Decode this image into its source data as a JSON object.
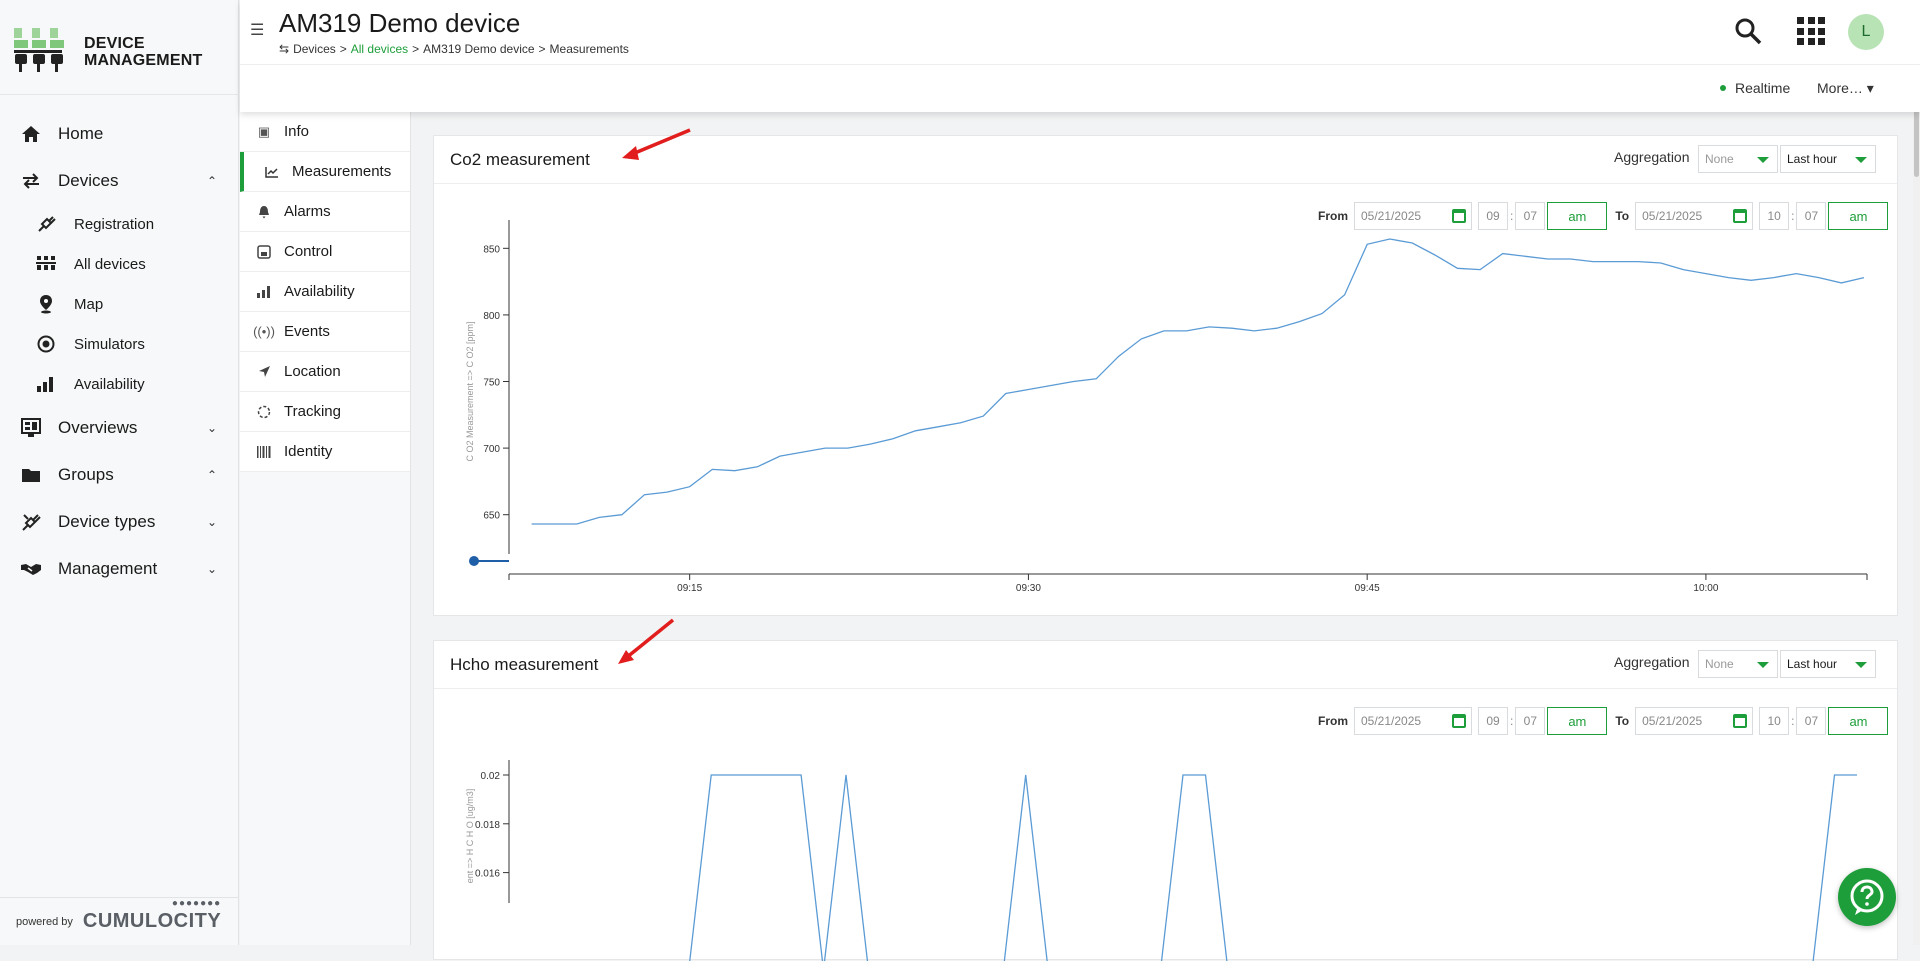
{
  "logo": {
    "line1": "DEVICE",
    "line2": "MANAGEMENT"
  },
  "nav": {
    "home": "Home",
    "devices": "Devices",
    "sub": [
      "Registration",
      "All devices",
      "Map",
      "Simulators",
      "Availability"
    ],
    "overviews": "Overviews",
    "groups": "Groups",
    "device_types": "Device types",
    "management": "Management"
  },
  "footer": {
    "powered": "powered by",
    "brand": "CUMULOCITY"
  },
  "header": {
    "title": "AM319 Demo device",
    "breadcrumb": [
      "Devices",
      ">",
      "All devices",
      ">",
      "AM319 Demo device",
      ">",
      "Measurements"
    ],
    "avatar": "L",
    "realtime": "Realtime",
    "more": "More…"
  },
  "tabs": [
    "Info",
    "Measurements",
    "Alarms",
    "Control",
    "Availability",
    "Events",
    "Location",
    "Tracking",
    "Identity"
  ],
  "cards": [
    {
      "title": "Co2 measurement",
      "aggregation_label": "Aggregation",
      "aggregation_value": "None",
      "interval": "Last hour",
      "from_label": "From",
      "to_label": "To",
      "from_date": "05/21/2025",
      "from_hour": "09",
      "from_min": "07",
      "from_ampm": "am",
      "to_date": "05/21/2025",
      "to_hour": "10",
      "to_min": "07",
      "to_ampm": "am"
    },
    {
      "title": "Hcho measurement",
      "aggregation_label": "Aggregation",
      "aggregation_value": "None",
      "interval": "Last hour",
      "from_label": "From",
      "to_label": "To",
      "from_date": "05/21/2025",
      "from_hour": "09",
      "from_min": "07",
      "from_ampm": "am",
      "to_date": "05/21/2025",
      "to_hour": "10",
      "to_min": "07",
      "to_ampm": "am"
    }
  ],
  "chart_data": [
    {
      "type": "line",
      "ylabel": "C O2 Measurement => C O2 [ppm]",
      "x_ticks": [
        "09:15",
        "09:30",
        "09:45",
        "10:00"
      ],
      "y_ticks": [
        650,
        700,
        750,
        800,
        850
      ],
      "ylim": [
        625,
        860
      ],
      "x_start": "09:07",
      "x_end": "10:07",
      "series": [
        {
          "x_min": [
            8,
            9,
            10,
            11,
            12,
            13,
            14,
            15,
            16,
            17,
            18,
            19,
            20,
            21,
            22,
            23,
            24,
            25,
            26,
            27,
            28,
            29,
            30,
            31,
            32,
            33,
            34,
            35,
            36,
            37,
            38,
            39,
            40,
            41,
            42,
            43,
            44,
            45,
            46,
            47,
            48,
            49,
            50,
            51,
            52,
            53,
            54,
            55,
            56,
            57,
            58,
            59,
            60,
            61,
            62,
            63,
            64,
            65,
            66,
            67
          ],
          "values": [
            643,
            643,
            643,
            648,
            650,
            665,
            667,
            671,
            684,
            683,
            686,
            694,
            697,
            700,
            700,
            703,
            707,
            713,
            716,
            719,
            724,
            741,
            744,
            747,
            750,
            752,
            769,
            782,
            788,
            788,
            791,
            790,
            788,
            790,
            795,
            801,
            815,
            853,
            857,
            854,
            845,
            835,
            834,
            846,
            844,
            842,
            842,
            840,
            840,
            840,
            839,
            834,
            831,
            828,
            826,
            828,
            831,
            828,
            824,
            828,
            835
          ]
        }
      ]
    },
    {
      "type": "line",
      "ylabel": "ent => H C H O [ug/m3]",
      "y_ticks": [
        0.016,
        0.018,
        0.02
      ],
      "ylim": [
        0.015,
        0.02
      ],
      "series": [
        {
          "x_min": [
            8,
            9,
            10,
            11,
            12,
            13,
            14,
            15,
            16,
            17,
            18,
            19,
            20,
            21,
            22,
            23,
            24,
            25,
            26,
            27,
            28,
            29,
            30,
            31,
            32,
            33,
            34,
            35,
            36,
            37,
            38,
            39,
            40,
            41,
            42,
            43,
            44,
            45,
            46,
            47,
            48,
            49,
            50,
            51,
            52,
            53,
            54,
            55,
            56,
            57,
            58,
            59,
            60,
            61,
            62,
            63,
            64,
            65,
            66,
            67
          ],
          "values": [
            0,
            0,
            0,
            0,
            0,
            0,
            0,
            0,
            0.02,
            0.02,
            0.02,
            0.02,
            0.02,
            0,
            0.02,
            0,
            0,
            0,
            0,
            0,
            0,
            0,
            0.02,
            0,
            0,
            0,
            0,
            0,
            0,
            0.02,
            0.02,
            0,
            0,
            0,
            0,
            0,
            0,
            0,
            0,
            0,
            0,
            0,
            0,
            0,
            0,
            0,
            0,
            0,
            0,
            0,
            0,
            0,
            0,
            0,
            0,
            0,
            0,
            0,
            0.02,
            0.02
          ]
        }
      ]
    }
  ]
}
